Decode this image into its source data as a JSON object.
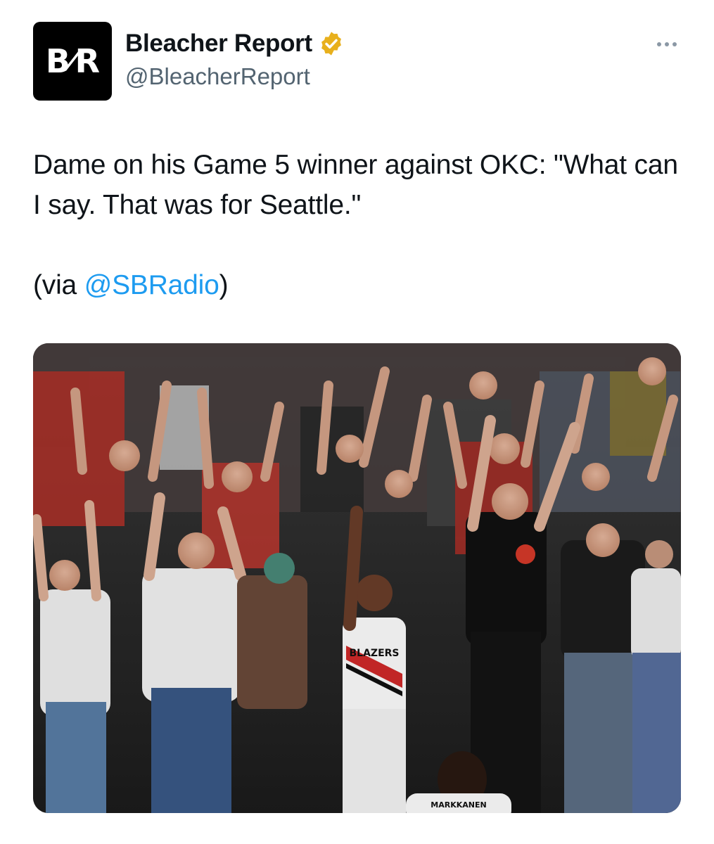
{
  "author": {
    "avatar_text": "B/R",
    "avatar_left": "B",
    "avatar_right": "R",
    "display_name": "Bleacher Report",
    "handle": "@BleacherReport",
    "verified_badge_color": "#e8b01c"
  },
  "actions": {
    "more_icon": "ellipsis-icon"
  },
  "tweet": {
    "line1": "Dame on his Game 5 winner against OKC: \"What can I say. That was for Seattle.\"",
    "via_prefix": "(via ",
    "via_mention": "@SBRadio",
    "via_suffix": ")",
    "link_color": "#1d9bf0"
  },
  "media": {
    "jersey_text": "BLAZERS",
    "back_jersey_text": "MARKKANEN"
  },
  "colors": {
    "text_primary": "#0f1419",
    "text_secondary": "#536471"
  }
}
